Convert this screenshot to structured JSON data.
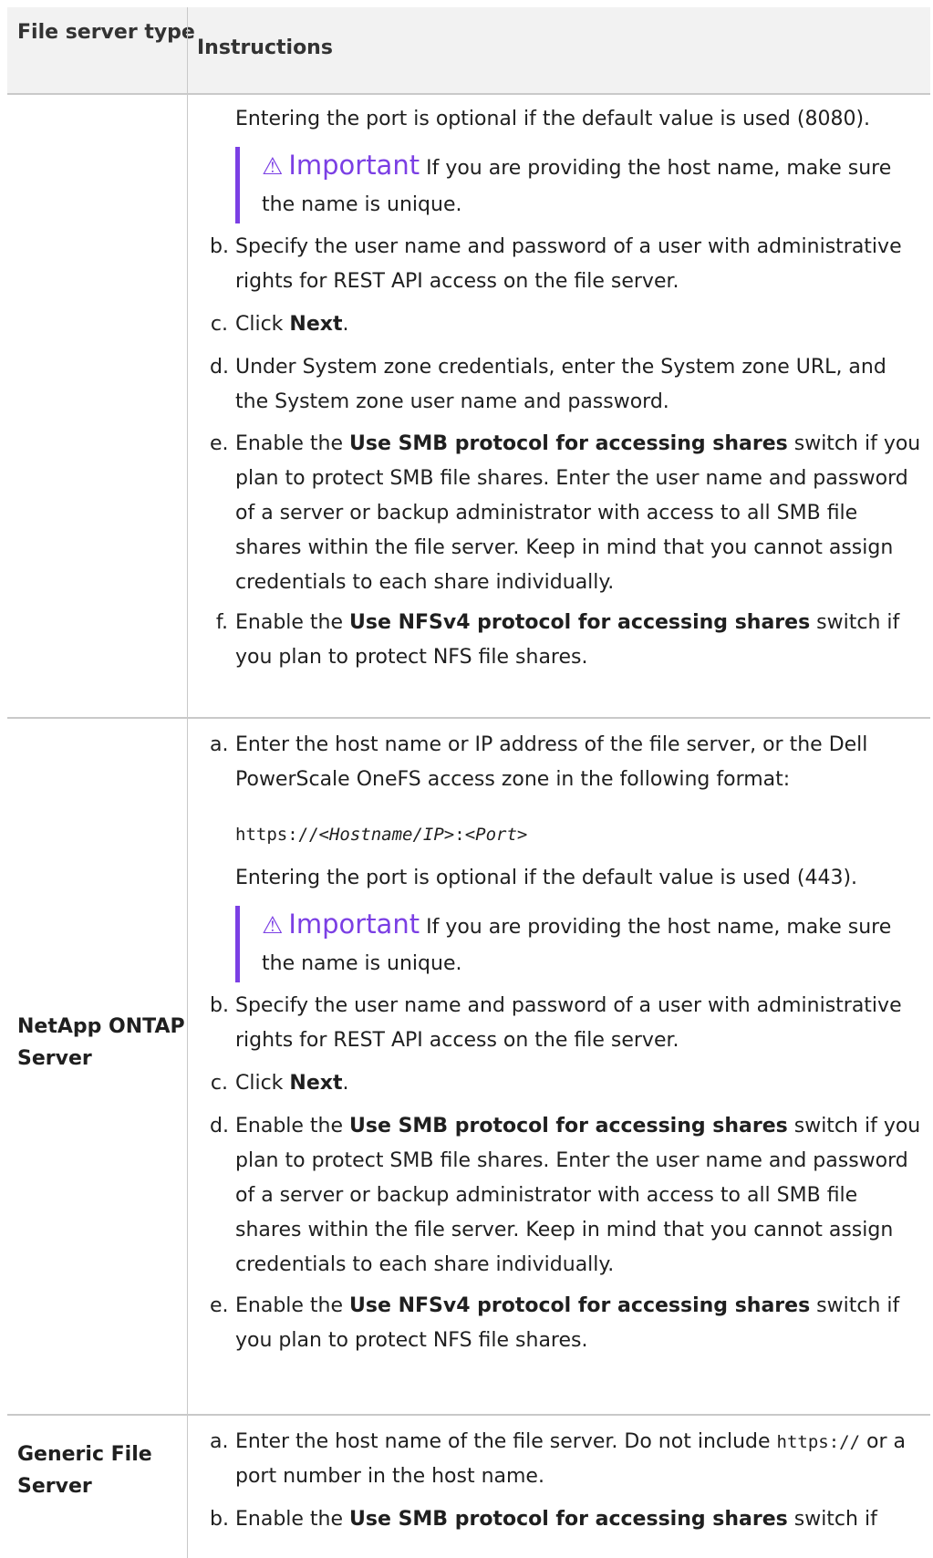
{
  "header": {
    "col1": "File server type",
    "col2": "Instructions"
  },
  "rows": [
    {
      "name": "",
      "port_note": "Entering the port is optional if the default value is used (8080).",
      "important": {
        "label": "Important",
        "text": "If you are providing the host name, make sure the name is unique."
      },
      "steps": [
        {
          "letter": "b.",
          "text": "Specify the user name and password of a user with administrative rights for REST API access on the file server."
        },
        {
          "letter": "c.",
          "pre": "Click ",
          "bold": "Next",
          "post": "."
        },
        {
          "letter": "d.",
          "text": "Under System zone credentials, enter the System zone URL, and the System zone user name and password."
        },
        {
          "letter": "e.",
          "pre": "Enable the ",
          "bold": "Use SMB protocol for accessing shares",
          "post": " switch if you plan to protect SMB file shares. Enter the user name and password of a server or backup administrator with access to all SMB file shares within the file server. Keep in mind that you cannot assign credentials to each share individually."
        },
        {
          "letter": "f.",
          "pre": "Enable the ",
          "bold": "Use NFSv4 protocol for accessing shares",
          "post": " switch if you plan to protect NFS file shares."
        }
      ]
    },
    {
      "name": "NetApp ONTAP Server",
      "step_a": {
        "letter": "a.",
        "text": "Enter the host name or IP address of the file server, or the Dell PowerScale OneFS access zone in the following format:"
      },
      "code": {
        "prefix": "https://",
        "host": "<Hostname/IP>",
        "sep": ":",
        "port": "<Port>"
      },
      "port_note": "Entering the port is optional if the default value is used (443).",
      "important": {
        "label": "Important",
        "text": "If you are providing the host name, make sure the name is unique."
      },
      "steps": [
        {
          "letter": "b.",
          "text": "Specify the user name and password of a user with administrative rights for REST API access on the file server."
        },
        {
          "letter": "c.",
          "pre": "Click ",
          "bold": "Next",
          "post": "."
        },
        {
          "letter": "d.",
          "pre": "Enable the ",
          "bold": "Use SMB protocol for accessing shares",
          "post": " switch if you plan to protect SMB file shares. Enter the user name and password of a server or backup administrator with access to all SMB file shares within the file server. Keep in mind that you cannot assign credentials to each share individually."
        },
        {
          "letter": "e.",
          "pre": "Enable the ",
          "bold": "Use NFSv4 protocol for accessing shares",
          "post": " switch if you plan to protect NFS file shares."
        }
      ]
    },
    {
      "name": "Generic File Server",
      "step_a": {
        "letter": "a.",
        "pre": "Enter the host name of the file server. Do not include ",
        "code": "https://",
        "post": " or a port number in the host name."
      },
      "step_b": {
        "letter": "b.",
        "pre": "Enable the ",
        "bold": "Use SMB protocol for accessing shares",
        "post": " switch if"
      }
    }
  ]
}
